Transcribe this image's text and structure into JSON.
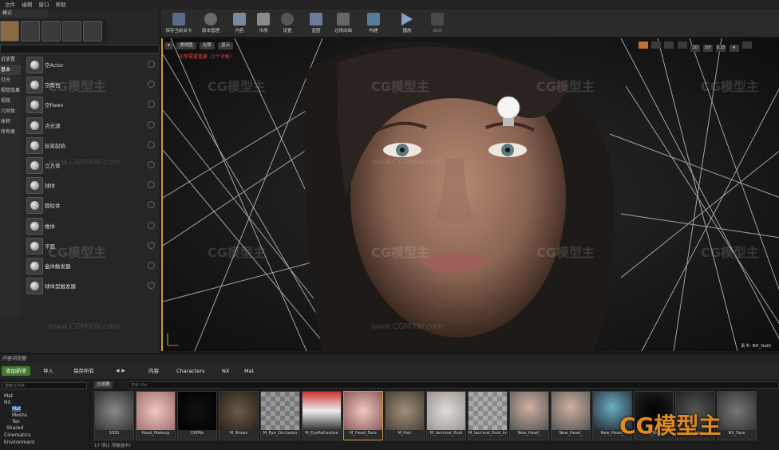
{
  "menu": [
    "文件",
    "编辑",
    "窗口",
    "帮助"
  ],
  "modes": {
    "tab_label": "模式",
    "categories": [
      "近放置",
      "基本",
      "灯光",
      "视觉效果",
      "视效",
      "几何体",
      "体积",
      "所有类"
    ],
    "items": [
      "空Actor",
      "空角色",
      "空Pawn",
      "点光源",
      "玩家起始",
      "立方体",
      "球体",
      "圆柱体",
      "椎体",
      "平面",
      "盒体触发器",
      "球体型触发器"
    ]
  },
  "toolbar": {
    "buttons": [
      "保存当前关卡",
      "版本管理",
      "内容",
      "市场",
      "设置",
      "蓝图",
      "过场动画",
      "构建",
      "播放",
      "启动"
    ]
  },
  "viewport": {
    "top_buttons": [
      "透视图",
      "光照",
      "显示"
    ],
    "warning": "光照需要重建（1个对象）",
    "right_values": [
      "10",
      "10°",
      "0.25",
      "4"
    ],
    "bottom_label": "关卡: NX_Gel0"
  },
  "content_browser": {
    "tab_label": "内容浏览器",
    "add_new": "添加新项",
    "import": "导入",
    "save_all": "保存所有",
    "breadcrumb": [
      "内容",
      "Characters",
      "NX",
      "Mat"
    ],
    "folder_search_placeholder": "搜索文件夹",
    "filter_label": "过滤器",
    "asset_search_placeholder": "搜索 Mat",
    "tree": [
      "Mat",
      "NX",
      "Mat",
      "Meshs",
      "Tex",
      "Shared",
      "Cinematics",
      "Environment"
    ],
    "assets": [
      "SSSS",
      "Head_Makeup",
      "DiffMa",
      "M_Brows",
      "M_Eye_Occlusion",
      "M_EyeRefractive",
      "M_Head_Face",
      "M_Hair",
      "M_lacrimal_fluid",
      "M_lacrimal_fluid_Inst",
      "New_Head_",
      "New_Head_",
      "New_Head_",
      "NX_Body",
      "NX_Hair",
      "NX_Face"
    ],
    "status": "17 项(1 项被选中)"
  },
  "watermark": {
    "text": "CG模型主",
    "url": "www.CGMXW.com",
    "brand": "CG模型主"
  },
  "colors": {
    "accent": "#c89a3a",
    "add_button": "#3d7a2a",
    "warning": "#e04040",
    "brand": "#e08a20"
  }
}
